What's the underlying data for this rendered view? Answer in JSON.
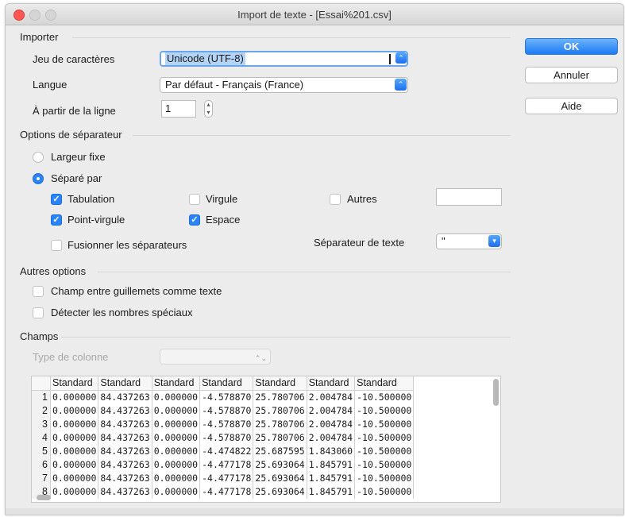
{
  "window": {
    "title": "Import de texte - [Essai%201.csv]"
  },
  "buttons": {
    "ok": "OK",
    "cancel": "Annuler",
    "help": "Aide"
  },
  "import": {
    "section": "Importer",
    "charset_label": "Jeu de caractères",
    "charset_value": "Unicode (UTF-8)",
    "language_label": "Langue",
    "language_value": "Par défaut - Français (France)",
    "from_line_label": "À partir de la ligne",
    "from_line_value": "1"
  },
  "separator": {
    "section": "Options de séparateur",
    "fixed_width_label": "Largeur fixe",
    "fixed_width_selected": false,
    "separated_by_label": "Séparé par",
    "separated_by_selected": true,
    "tab_label": "Tabulation",
    "tab_checked": true,
    "comma_label": "Virgule",
    "comma_checked": false,
    "other_label": "Autres",
    "other_checked": false,
    "other_value": "",
    "semicolon_label": "Point-virgule",
    "semicolon_checked": true,
    "space_label": "Espace",
    "space_checked": true,
    "merge_label": "Fusionner les séparateurs",
    "merge_checked": false,
    "text_delimiter_label": "Séparateur de texte",
    "text_delimiter_value": "\""
  },
  "other_options": {
    "section": "Autres options",
    "quoted_as_text_label": "Champ entre guillemets comme texte",
    "quoted_as_text_checked": false,
    "detect_special_label": "Détecter les nombres spéciaux",
    "detect_special_checked": false
  },
  "fields": {
    "section": "Champs",
    "column_type_label": "Type de colonne",
    "column_type_value": "",
    "headers": [
      "Standard",
      "Standard",
      "Standard",
      "Standard",
      "Standard",
      "Standard",
      "Standard"
    ],
    "rows": [
      [
        "1",
        "0.000000",
        "84.437263",
        "0.000000",
        "-4.578870",
        "25.780706",
        "2.004784",
        "-10.500000"
      ],
      [
        "2",
        "0.000000",
        "84.437263",
        "0.000000",
        "-4.578870",
        "25.780706",
        "2.004784",
        "-10.500000"
      ],
      [
        "3",
        "0.000000",
        "84.437263",
        "0.000000",
        "-4.578870",
        "25.780706",
        "2.004784",
        "-10.500000"
      ],
      [
        "4",
        "0.000000",
        "84.437263",
        "0.000000",
        "-4.578870",
        "25.780706",
        "2.004784",
        "-10.500000"
      ],
      [
        "5",
        "0.000000",
        "84.437263",
        "0.000000",
        "-4.474822",
        "25.687595",
        "1.843060",
        "-10.500000"
      ],
      [
        "6",
        "0.000000",
        "84.437263",
        "0.000000",
        "-4.477178",
        "25.693064",
        "1.845791",
        "-10.500000"
      ],
      [
        "7",
        "0.000000",
        "84.437263",
        "0.000000",
        "-4.477178",
        "25.693064",
        "1.845791",
        "-10.500000"
      ],
      [
        "8",
        "0.000000",
        "84.437263",
        "0.000000",
        "-4.477178",
        "25.693064",
        "1.845791",
        "-10.500000"
      ]
    ]
  },
  "colors": {
    "accent": "#2a84f7",
    "window_bg": "#ececec"
  }
}
